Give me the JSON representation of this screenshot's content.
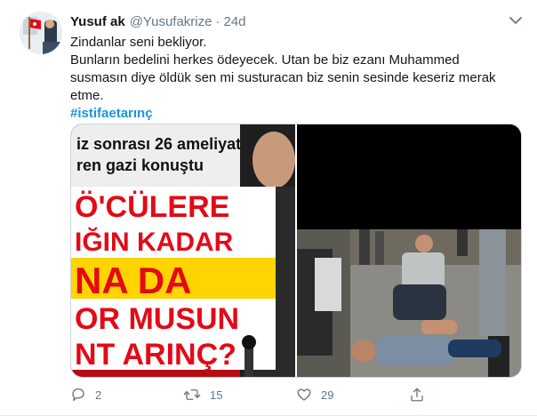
{
  "tweet": {
    "author_name": "Yusuf ak",
    "handle": "@Yusufakrize",
    "separator": "·",
    "time": "24d",
    "lines": [
      "Zindanlar seni bekliyor.",
      "Bunların bedelini herkes ödeyecek. Utan be biz ezanı Muhammed",
      "susmasın diye öldük sen mi susturacan biz senin sesinde keseriz merak",
      "etme."
    ],
    "hashtag": "#istifaetarınç"
  },
  "media": {
    "left_image": {
      "headline_line1": "iz sonrası 26 ameliyat",
      "headline_line2": "ren gazi konuştu",
      "big_line1": "Ö'CÜLERE",
      "big_line2": "IĞIN KADAR",
      "big_line3": "NA DA",
      "big_line4": "OR MUSUN",
      "big_line5": "NT ARINÇ?"
    }
  },
  "actions": {
    "reply_count": "2",
    "retweet_count": "15",
    "like_count": "29"
  },
  "colors": {
    "accent": "#1b95e0",
    "secondary_text": "#657786",
    "headline_red": "#e30a17",
    "headline_yellow": "#ffd400"
  },
  "icons": {
    "reply": "reply-icon",
    "retweet": "retweet-icon",
    "like": "heart-icon",
    "share": "share-icon",
    "more": "chevron-down-icon"
  }
}
